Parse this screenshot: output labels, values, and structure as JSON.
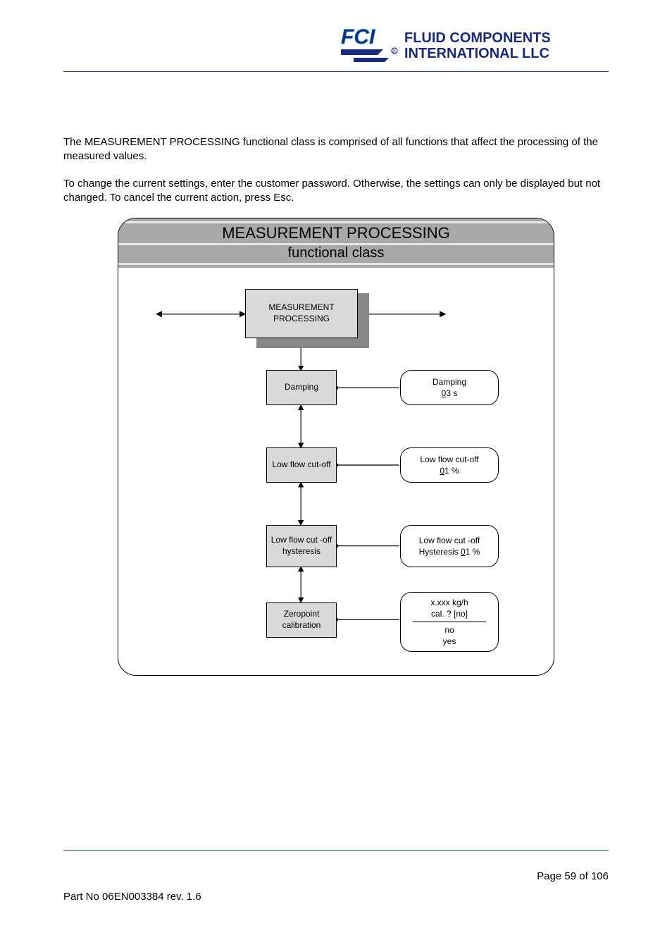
{
  "header": {
    "logo_main": "FLUID COMPONENTS",
    "logo_sub": "INTERNATIONAL LLC",
    "logo_prefix": "FCI"
  },
  "content": {
    "para1": "The MEASUREMENT PROCESSING functional class is comprised of all functions that affect the processing of the measured values.",
    "para2": "To change the current settings, enter the customer password. Otherwise, the settings can only be displayed but not changed. To cancel the current action, press Esc."
  },
  "diagram": {
    "title": "MEASUREMENT PROCESSING",
    "subtitle": "functional class",
    "root": {
      "line1": "MEASUREMENT",
      "line2": "PROCESSING"
    },
    "nodes": {
      "damping": "Damping",
      "lowflow": "Low flow cut-off",
      "lowflowhyst": {
        "line1": "Low flow cut -off",
        "line2": "hysteresis"
      },
      "zeropoint": {
        "line1": "Zeropoint",
        "line2": "calibration"
      }
    },
    "values": {
      "damping": {
        "label": "Damping",
        "value_pre": "0",
        "value_post": "3 s"
      },
      "lowflow": {
        "label": "Low flow cut-off",
        "value_pre": "0",
        "value_post": "1 %"
      },
      "lowflowhyst": {
        "label": "Low flow cut -off",
        "value_label": "Hysteresis ",
        "value_pre": "0",
        "value_post": "1 %"
      },
      "zeropoint": {
        "line1": "x.xxx kg/h",
        "line2": "cal. ? [no]",
        "opt1": "no",
        "opt2": "yes"
      }
    }
  },
  "footer": {
    "page": "Page 59 of 106",
    "part": "Part No 06EN003384 rev. 1.6"
  }
}
